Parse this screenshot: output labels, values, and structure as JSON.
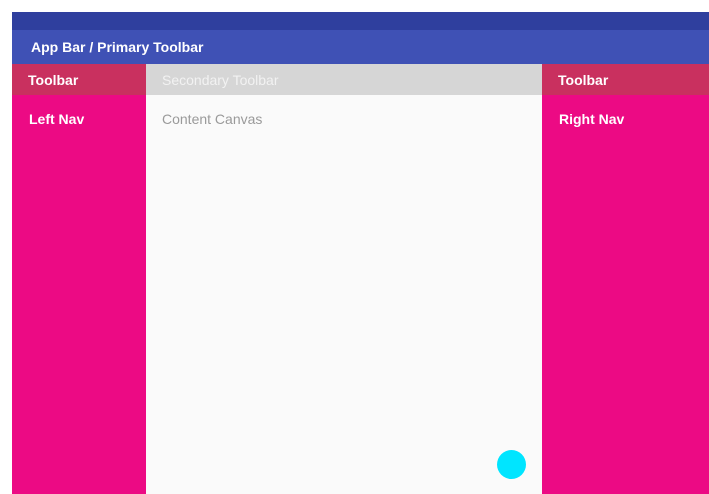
{
  "app_bar": {
    "title": "App Bar / Primary Toolbar"
  },
  "left_panel": {
    "toolbar_label": "Toolbar",
    "nav_label": "Left Nav"
  },
  "center_panel": {
    "toolbar_label": "Secondary Toolbar",
    "canvas_label": "Content Canvas"
  },
  "right_panel": {
    "toolbar_label": "Toolbar",
    "nav_label": "Right Nav"
  },
  "colors": {
    "status_bar": "#2f3f9e",
    "app_bar": "#3f51b5",
    "side_panels": "#ec0a84",
    "side_toolbars": "#c9305f",
    "secondary_toolbar": "#d6d6d6",
    "canvas": "#fafafa",
    "fab": "#00e5ff"
  },
  "fab": {
    "icon": "circle-action-icon"
  }
}
